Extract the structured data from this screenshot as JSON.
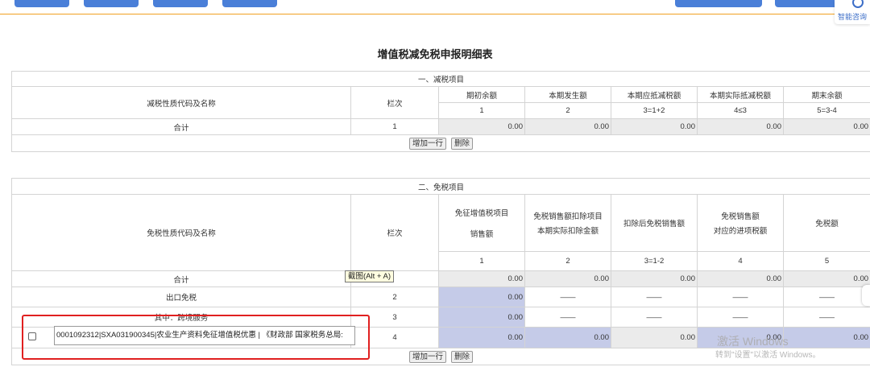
{
  "assistant": {
    "label": "智能咨询"
  },
  "title": "增值税减免税申报明细表",
  "section1": {
    "header": "一、减税项目",
    "col_name": "减税性质代码及名称",
    "col_line": "栏次",
    "cols": [
      "期初余额",
      "本期发生额",
      "本期应抵减税额",
      "本期实际抵减税额",
      "期末余额"
    ],
    "col_nums": [
      "1",
      "2",
      "3=1+2",
      "4≤3",
      "5=3-4"
    ],
    "total": {
      "label": "合计",
      "line": "1",
      "values": [
        "0.00",
        "0.00",
        "0.00",
        "0.00",
        "0.00"
      ]
    },
    "add_button": "增加一行",
    "delete_button": "删除"
  },
  "section2": {
    "header": "二、免税项目",
    "col_name": "免税性质代码及名称",
    "col_line": "栏次",
    "cols": [
      {
        "line1": "免征增值税项目",
        "line2": "销售额"
      },
      {
        "line1": "免税销售额扣除项目",
        "line2": "本期实际扣除金额"
      },
      {
        "line1": "扣除后免税销售额",
        "line2": ""
      },
      {
        "line1": "免税销售额",
        "line2": "对应的进项税额"
      },
      {
        "line1": "免税额",
        "line2": ""
      }
    ],
    "col_nums": [
      "1",
      "2",
      "3=1-2",
      "4",
      "5"
    ],
    "total": {
      "label": "合计",
      "line": "",
      "values": [
        "0.00",
        "0.00",
        "0.00",
        "0.00",
        "0.00"
      ]
    },
    "export": {
      "label": "出口免税",
      "line": "2",
      "value": "0.00",
      "dash": "——"
    },
    "crossborder": {
      "label": "其中：跨境服务",
      "line": "3",
      "value": "0.00",
      "dash": "——"
    },
    "item": {
      "code": "0001092312|SXA031900345|农业生产资料免征增值税优惠 | 《财政部 国家税务总局:",
      "line": "4",
      "values": [
        "0.00",
        "0.00",
        "0.00",
        "0.00",
        "0.00"
      ]
    },
    "add_button": "增加一行",
    "delete_button": "删除"
  },
  "tooltip": "截图(Alt + A)",
  "watermark": {
    "line1": "激活 Windows",
    "line2": "转到\"设置\"以激活 Windows。"
  }
}
